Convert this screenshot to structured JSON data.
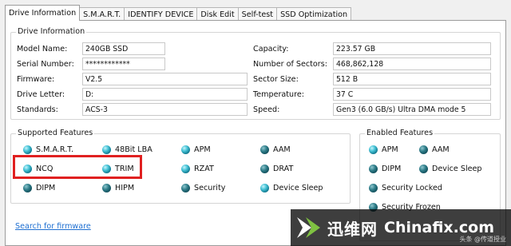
{
  "tabs": [
    {
      "label": "Drive Information",
      "active": true
    },
    {
      "label": "S.M.A.R.T.",
      "active": false
    },
    {
      "label": "IDENTIFY DEVICE",
      "active": false
    },
    {
      "label": "Disk Edit",
      "active": false
    },
    {
      "label": "Self-test",
      "active": false
    },
    {
      "label": "SSD Optimization",
      "active": false
    }
  ],
  "drive_info": {
    "title": "Drive Information",
    "left": [
      {
        "label": "Model Name:",
        "value": "240GB SSD"
      },
      {
        "label": "Serial Number:",
        "value": "************"
      },
      {
        "label": "Firmware:",
        "value": "V2.5"
      },
      {
        "label": "Drive Letter:",
        "value": "D:"
      },
      {
        "label": "Standards:",
        "value": "ACS-3"
      }
    ],
    "right": [
      {
        "label": "Capacity:",
        "value": "223.57 GB"
      },
      {
        "label": "Number of Sectors:",
        "value": "468,862,128"
      },
      {
        "label": "Sector Size:",
        "value": "512 B"
      },
      {
        "label": "Temperature:",
        "value": "37 C"
      },
      {
        "label": "Speed:",
        "value": "Gen3 (6.0 GB/s) Ultra DMA mode 5"
      }
    ]
  },
  "supported": {
    "title": "Supported Features",
    "items": [
      {
        "label": "S.M.A.R.T.",
        "state": "on"
      },
      {
        "label": "48Bit LBA",
        "state": "on"
      },
      {
        "label": "APM",
        "state": "on"
      },
      {
        "label": "AAM",
        "state": "off"
      },
      {
        "label": "NCQ",
        "state": "on"
      },
      {
        "label": "TRIM",
        "state": "on"
      },
      {
        "label": "RZAT",
        "state": "on"
      },
      {
        "label": "DRAT",
        "state": "off"
      },
      {
        "label": "DIPM",
        "state": "off"
      },
      {
        "label": "HIPM",
        "state": "off"
      },
      {
        "label": "Security",
        "state": "off"
      },
      {
        "label": "Device Sleep",
        "state": "on"
      }
    ]
  },
  "enabled": {
    "title": "Enabled Features",
    "items": [
      {
        "label": "APM",
        "state": "on"
      },
      {
        "label": "AAM",
        "state": "off"
      },
      {
        "label": "DIPM",
        "state": "off"
      },
      {
        "label": "Device Sleep",
        "state": "off"
      },
      {
        "label": "Security Locked",
        "state": "off"
      },
      {
        "label": "Security Frozen",
        "state": "off"
      }
    ]
  },
  "link": {
    "label": "Search for firmware"
  },
  "watermark": {
    "brand": "迅维网",
    "site": "Chinafix.com",
    "small": "头条 @传道授业"
  },
  "colors": {
    "highlight": "#e02020",
    "link": "#1e6fd1",
    "dot_on": "#2fb3c8",
    "dot_off": "#1d6572"
  }
}
